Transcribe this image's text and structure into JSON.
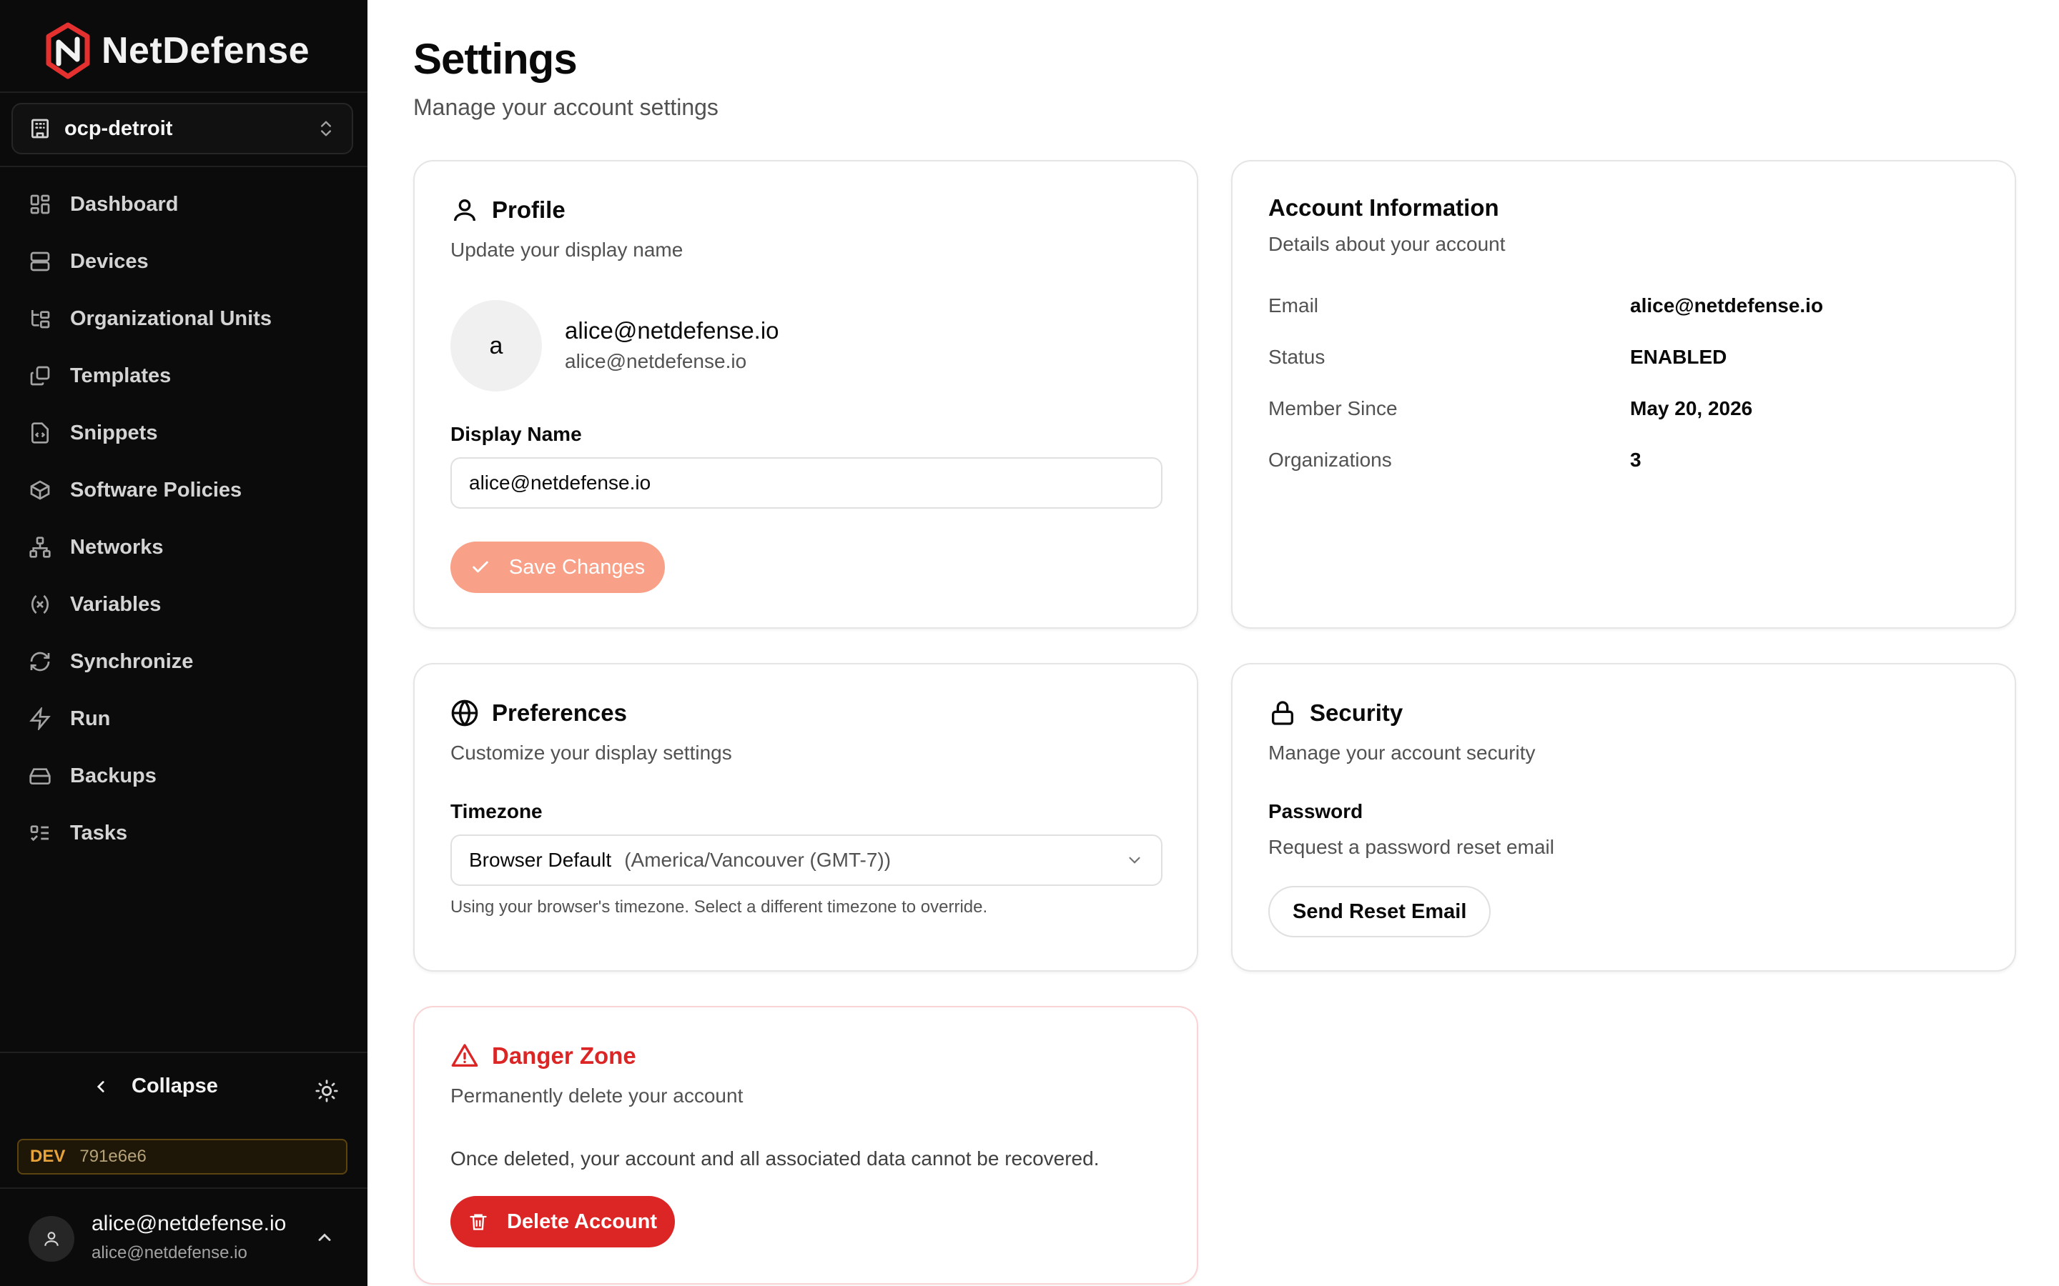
{
  "brand": {
    "name": "NetDefense"
  },
  "org_switcher": {
    "label": "ocp-detroit"
  },
  "nav": [
    {
      "label": "Dashboard",
      "icon": "dashboard-icon"
    },
    {
      "label": "Devices",
      "icon": "server-icon"
    },
    {
      "label": "Organizational Units",
      "icon": "tree-icon"
    },
    {
      "label": "Templates",
      "icon": "copy-icon"
    },
    {
      "label": "Snippets",
      "icon": "code-file-icon"
    },
    {
      "label": "Software Policies",
      "icon": "package-icon"
    },
    {
      "label": "Networks",
      "icon": "network-icon"
    },
    {
      "label": "Variables",
      "icon": "variable-icon"
    },
    {
      "label": "Synchronize",
      "icon": "refresh-icon"
    },
    {
      "label": "Run",
      "icon": "bolt-icon"
    },
    {
      "label": "Backups",
      "icon": "hard-drive-icon"
    },
    {
      "label": "Tasks",
      "icon": "list-todo-icon"
    }
  ],
  "sidebar_footer": {
    "collapse_label": "Collapse",
    "dev_tag": "DEV",
    "dev_hash": "791e6e6",
    "user_name": "alice@netdefense.io",
    "user_email": "alice@netdefense.io"
  },
  "page": {
    "title": "Settings",
    "subtitle": "Manage your account settings"
  },
  "profile": {
    "title": "Profile",
    "description": "Update your display name",
    "avatar_initial": "a",
    "name": "alice@netdefense.io",
    "email": "alice@netdefense.io",
    "display_name_label": "Display Name",
    "display_name_value": "alice@netdefense.io",
    "save_label": "Save Changes"
  },
  "account_info": {
    "title": "Account Information",
    "description": "Details about your account",
    "rows": [
      {
        "key": "Email",
        "value": "alice@netdefense.io"
      },
      {
        "key": "Status",
        "value": "ENABLED"
      },
      {
        "key": "Member Since",
        "value": "May 20, 2026"
      },
      {
        "key": "Organizations",
        "value": "3"
      }
    ]
  },
  "preferences": {
    "title": "Preferences",
    "description": "Customize your display settings",
    "timezone_label": "Timezone",
    "timezone_value": "Browser Default",
    "timezone_detail": "(America/Vancouver (GMT-7))",
    "help": "Using your browser's timezone. Select a different timezone to override."
  },
  "security": {
    "title": "Security",
    "description": "Manage your account security",
    "password_label": "Password",
    "password_desc": "Request a password reset email",
    "reset_label": "Send Reset Email"
  },
  "danger": {
    "title": "Danger Zone",
    "description": "Permanently delete your account",
    "warning": "Once deleted, your account and all associated data cannot be recovered.",
    "delete_label": "Delete Account"
  },
  "colors": {
    "sidebar_bg": "#0b0b0b",
    "accent": "#f8a088",
    "danger": "#dc2626",
    "brand_red": "#e4312f"
  }
}
